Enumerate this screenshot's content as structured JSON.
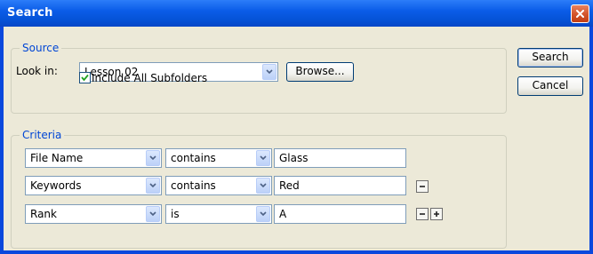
{
  "window": {
    "title": "Search"
  },
  "source": {
    "group_label": "Source",
    "look_in_label": "Look in:",
    "look_in_value": "Lesson 02",
    "browse_label": "Browse...",
    "include_subfolders_label": "Include All Subfolders",
    "include_subfolders_checked": true
  },
  "criteria": {
    "group_label": "Criteria",
    "rows": [
      {
        "field": "File Name",
        "operator": "contains",
        "value": "Glass"
      },
      {
        "field": "Keywords",
        "operator": "contains",
        "value": "Red"
      },
      {
        "field": "Rank",
        "operator": "is",
        "value": "A"
      }
    ]
  },
  "buttons": {
    "search_label": "Search",
    "cancel_label": "Cancel"
  },
  "icons": {
    "close": "close-icon",
    "dropdown": "chevron-down-icon",
    "remove": "minus-icon",
    "add": "plus-icon",
    "check": "check-icon"
  },
  "colors": {
    "titlebar": "#0a5ae6",
    "client": "#ece9d8",
    "group_label": "#0046d5"
  }
}
